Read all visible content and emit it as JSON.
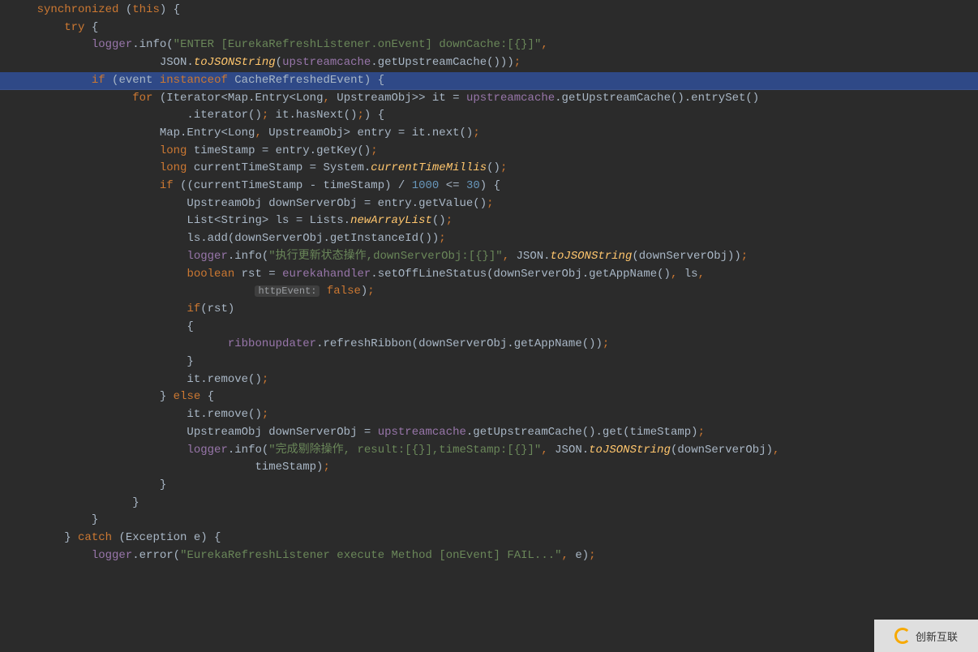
{
  "watermark": "创新互联",
  "lines": [
    {
      "t": "<span class='kw'>synchronized </span>(<span class='kw'>this</span>) {",
      "i": 2,
      "hl": false
    },
    {
      "t": "<span class='kw'>try </span>{",
      "i": 4,
      "hl": false
    },
    {
      "t": "<span class='fld'>logger</span>.info(<span class='str'>\"ENTER [EurekaRefreshListener.onEvent] downCache:[{}]\"</span><span class='esc'>,</span>",
      "i": 6,
      "hl": false
    },
    {
      "t": "JSON.<span class='mth-it'>toJSONString</span>(<span class='fld'>upstreamcache</span>.getUpstreamCache()))<span class='esc'>;</span>",
      "i": 11,
      "hl": false
    },
    {
      "t": "<span class='kw'>if </span>(event <span class='kw'>instanceof </span>CacheRefreshedEvent) {",
      "i": 6,
      "hl": true
    },
    {
      "t": "<span class='kw'>for </span>(Iterator&lt;Map.Entry&lt;Long<span class='esc'>, </span>UpstreamObj&gt;&gt; it = <span class='fld'>upstreamcache</span>.getUpstreamCache().entrySet()",
      "i": 9,
      "hl": false
    },
    {
      "t": ".iterator()<span class='esc'>; </span>it.hasNext()<span class='esc'>;</span>) {",
      "i": 13,
      "hl": false
    },
    {
      "t": "Map.Entry&lt;Long<span class='esc'>, </span>UpstreamObj&gt; entry = it.next()<span class='esc'>;</span>",
      "i": 11,
      "hl": false
    },
    {
      "t": "<span class='kw'>long </span>timeStamp = entry.getKey()<span class='esc'>;</span>",
      "i": 11,
      "hl": false
    },
    {
      "t": "<span class='kw'>long </span>currentTimeStamp = System.<span class='mth-it'>currentTimeMillis</span>()<span class='esc'>;</span>",
      "i": 11,
      "hl": false
    },
    {
      "t": "<span class='kw'>if </span>((currentTimeStamp - timeStamp) / <span class='num'>1000 </span>&lt;= <span class='num'>30</span>) {",
      "i": 11,
      "hl": false
    },
    {
      "t": "UpstreamObj downServerObj = entry.getValue()<span class='esc'>;</span>",
      "i": 13,
      "hl": false
    },
    {
      "t": "List&lt;String&gt; ls = Lists.<span class='mth-it'>newArrayList</span>()<span class='esc'>;</span>",
      "i": 13,
      "hl": false
    },
    {
      "t": "ls.add(downServerObj.getInstanceId())<span class='esc'>;</span>",
      "i": 13,
      "hl": false
    },
    {
      "t": "<span class='fld'>logger</span>.info(<span class='str'>\"执行更新状态操作,downServerObj:[{}]\"</span><span class='esc'>, </span>JSON.<span class='mth-it'>toJSONString</span>(downServerObj))<span class='esc'>;</span>",
      "i": 13,
      "hl": false
    },
    {
      "t": "<span class='kw'>boolean </span>rst = <span class='fld'>eurekahandler</span>.setOffLineStatus(downServerObj.getAppName()<span class='esc'>, </span>ls<span class='esc'>,</span>",
      "i": 13,
      "hl": false
    },
    {
      "t": "<span class='param-hint'>httpEvent:</span> <span class='kw'>false</span>)<span class='esc'>;</span>",
      "i": 18,
      "hl": false
    },
    {
      "t": "",
      "i": 0,
      "hl": false
    },
    {
      "t": "<span class='kw'>if</span>(rst)",
      "i": 13,
      "hl": false
    },
    {
      "t": "{",
      "i": 13,
      "hl": false
    },
    {
      "t": "<span class='fld'>ribbonupdater</span>.refreshRibbon(downServerObj.getAppName())<span class='esc'>;</span>",
      "i": 16,
      "hl": false
    },
    {
      "t": "}",
      "i": 13,
      "hl": false
    },
    {
      "t": "",
      "i": 0,
      "hl": false
    },
    {
      "t": "it.remove()<span class='esc'>;</span>",
      "i": 13,
      "hl": false
    },
    {
      "t": "} <span class='kw'>else </span>{",
      "i": 11,
      "hl": false
    },
    {
      "t": "it.remove()<span class='esc'>;</span>",
      "i": 13,
      "hl": false
    },
    {
      "t": "UpstreamObj downServerObj = <span class='fld'>upstreamcache</span>.getUpstreamCache().get(timeStamp)<span class='esc'>;</span>",
      "i": 13,
      "hl": false
    },
    {
      "t": "<span class='fld'>logger</span>.info(<span class='str'>\"完成剔除操作, result:[{}],timeStamp:[{}]\"</span><span class='esc'>, </span>JSON.<span class='mth-it'>toJSONString</span>(downServerObj)<span class='esc'>,</span>",
      "i": 13,
      "hl": false
    },
    {
      "t": "timeStamp)<span class='esc'>;</span>",
      "i": 18,
      "hl": false
    },
    {
      "t": "}",
      "i": 11,
      "hl": false
    },
    {
      "t": "}",
      "i": 9,
      "hl": false
    },
    {
      "t": "",
      "i": 0,
      "hl": false
    },
    {
      "t": "}",
      "i": 6,
      "hl": false
    },
    {
      "t": "} <span class='kw'>catch </span>(Exception e) {",
      "i": 4,
      "hl": false
    },
    {
      "t": "<span class='fld'>logger</span>.error(<span class='str'>\"EurekaRefreshListener execute Method [onEvent] FAIL...\"</span><span class='esc'>, </span>e)<span class='esc'>;</span>",
      "i": 6,
      "hl": false
    },
    {
      "t": " ",
      "i": 0,
      "hl": false
    }
  ]
}
